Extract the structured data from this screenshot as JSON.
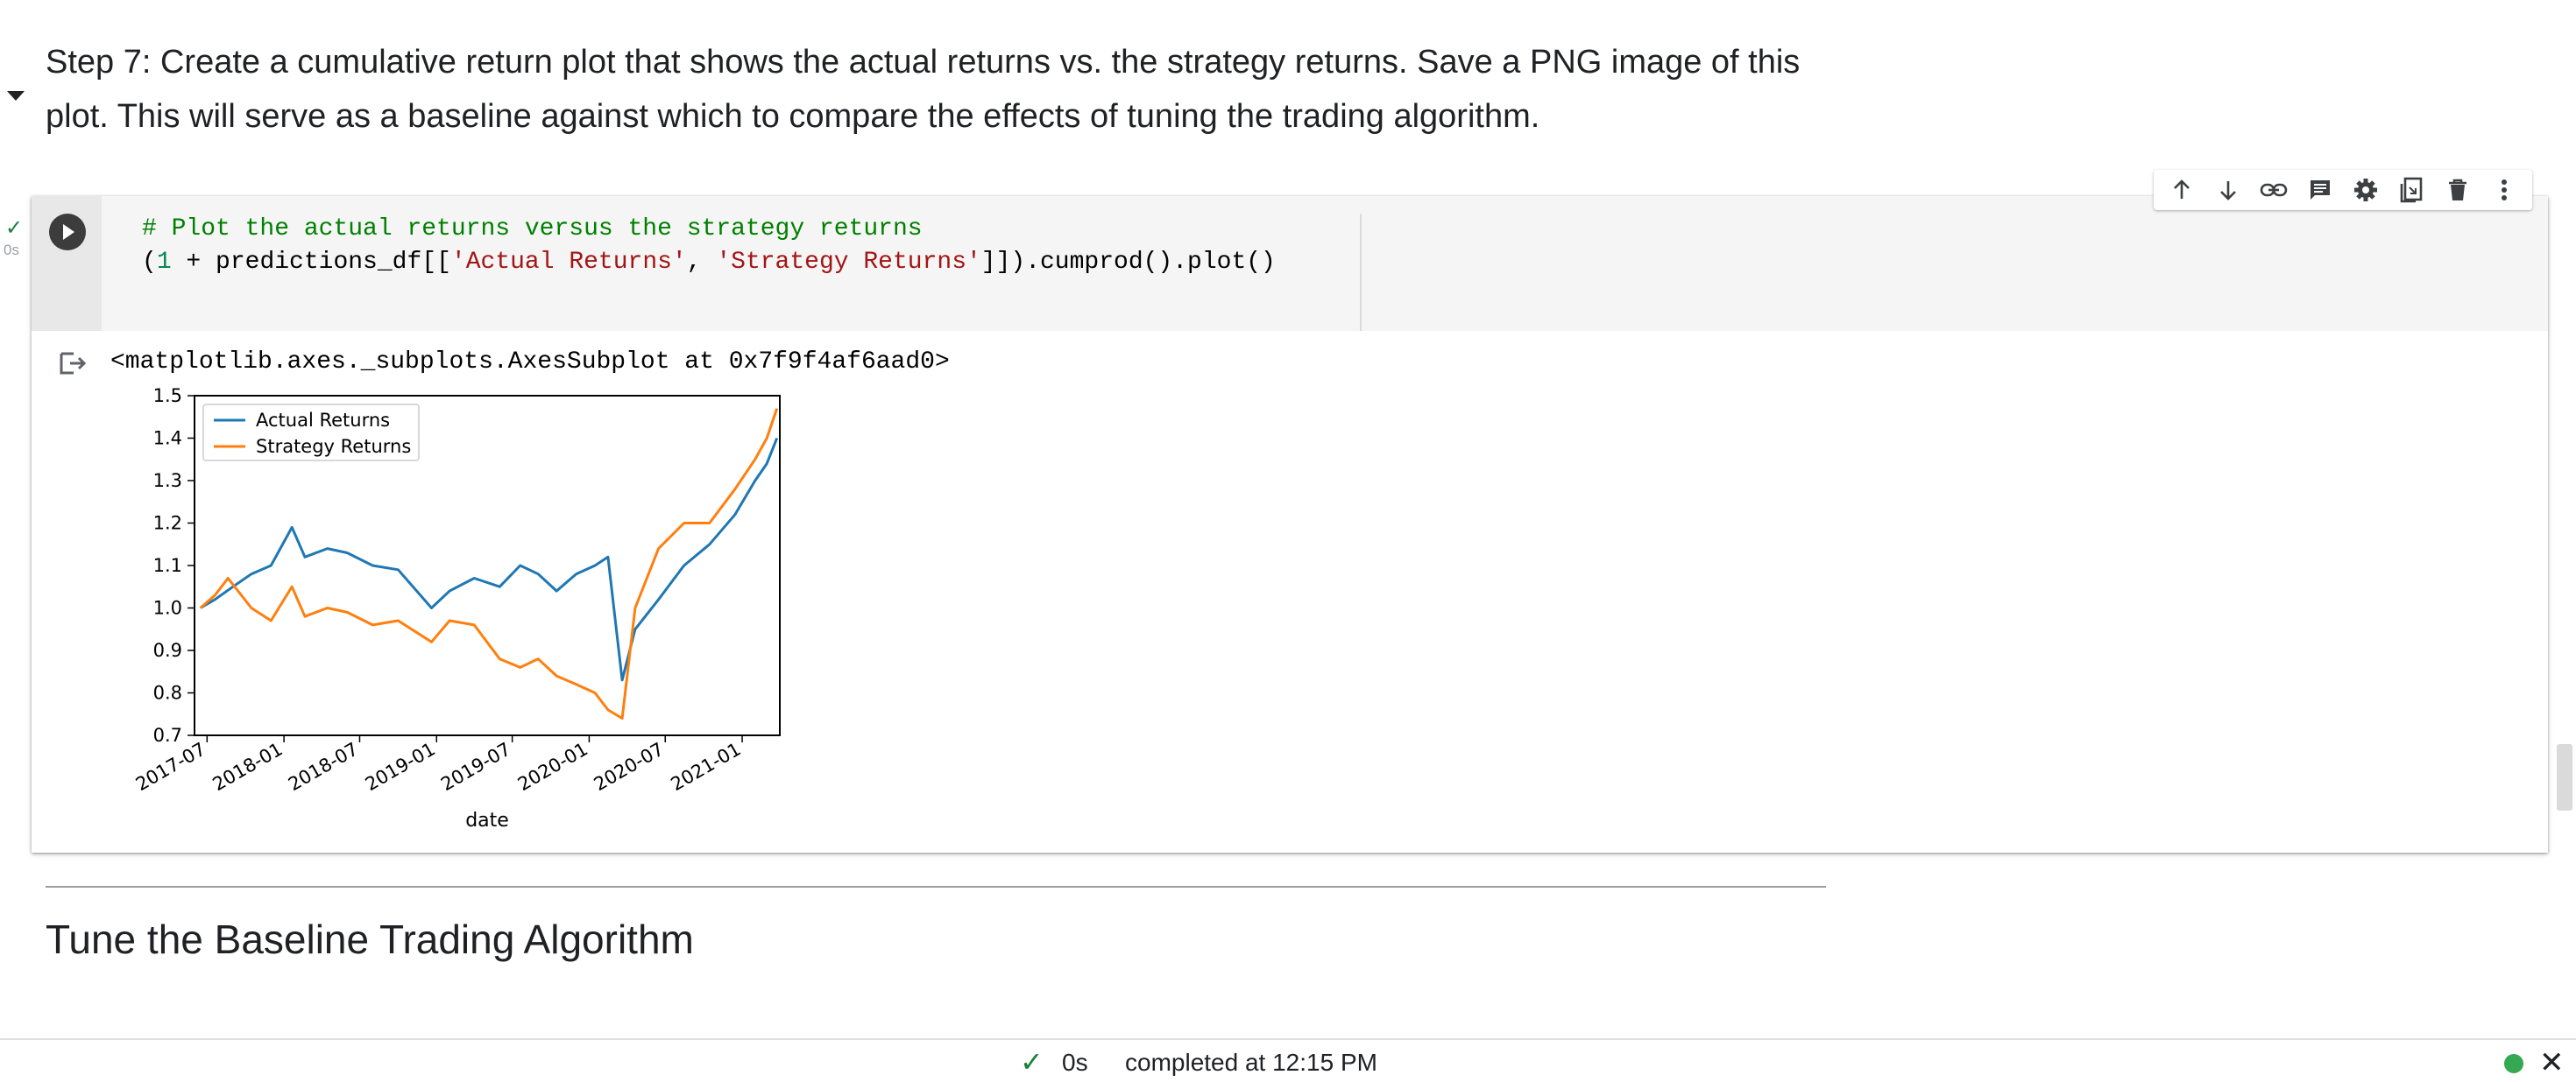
{
  "markdown": {
    "step_text": "Step 7: Create a cumulative return plot that shows the actual returns vs. the strategy returns. Save a PNG image of this plot. This will serve as a baseline against which to compare the effects of tuning the trading algorithm."
  },
  "cell": {
    "exec_time": "0s",
    "code_comment": "# Plot the actual returns versus the strategy returns",
    "code_open": "(",
    "code_num": "1",
    "code_mid": " + predictions_df[[",
    "code_str1": "'Actual Returns'",
    "code_comma": ", ",
    "code_str2": "'Strategy Returns'",
    "code_end": "]]).cumprod().plot()",
    "output_repr": "<matplotlib.axes._subplots.AxesSubplot at 0x7f9f4af6aad0>"
  },
  "toolbar": {
    "icons": [
      "arrow-up-icon",
      "arrow-down-icon",
      "link-icon",
      "comment-icon",
      "gear-icon",
      "mirror-cell-icon",
      "trash-icon",
      "more-vert-icon"
    ]
  },
  "chart_data": {
    "type": "line",
    "title": "",
    "xlabel": "date",
    "ylabel": "",
    "x_ticks": [
      "2017-07",
      "2018-01",
      "2018-07",
      "2019-01",
      "2019-07",
      "2020-01",
      "2020-07",
      "2021-01"
    ],
    "y_ticks": [
      "0.7",
      "0.8",
      "0.9",
      "1.0",
      "1.1",
      "1.2",
      "1.3",
      "1.4",
      "1.5"
    ],
    "ylim": [
      0.7,
      1.5
    ],
    "xlim": [
      "2017-06",
      "2021-04"
    ],
    "legend_position": "top-left",
    "grid": false,
    "series": [
      {
        "name": "Actual Returns",
        "color": "#1f77b4",
        "points": [
          [
            "2017-06-15",
            1.0
          ],
          [
            "2017-07-20",
            1.02
          ],
          [
            "2017-09-01",
            1.05
          ],
          [
            "2017-10-15",
            1.08
          ],
          [
            "2017-12-01",
            1.1
          ],
          [
            "2018-01-20",
            1.19
          ],
          [
            "2018-02-20",
            1.12
          ],
          [
            "2018-04-15",
            1.14
          ],
          [
            "2018-06-01",
            1.13
          ],
          [
            "2018-08-01",
            1.1
          ],
          [
            "2018-10-01",
            1.09
          ],
          [
            "2018-12-20",
            1.0
          ],
          [
            "2019-02-01",
            1.04
          ],
          [
            "2019-04-01",
            1.07
          ],
          [
            "2019-06-01",
            1.05
          ],
          [
            "2019-07-20",
            1.1
          ],
          [
            "2019-09-01",
            1.08
          ],
          [
            "2019-10-15",
            1.04
          ],
          [
            "2019-12-01",
            1.08
          ],
          [
            "2020-01-15",
            1.1
          ],
          [
            "2020-02-15",
            1.12
          ],
          [
            "2020-03-20",
            0.83
          ],
          [
            "2020-04-20",
            0.95
          ],
          [
            "2020-06-15",
            1.02
          ],
          [
            "2020-08-15",
            1.1
          ],
          [
            "2020-10-15",
            1.15
          ],
          [
            "2020-12-15",
            1.22
          ],
          [
            "2021-02-01",
            1.3
          ],
          [
            "2021-03-01",
            1.34
          ],
          [
            "2021-03-25",
            1.4
          ]
        ]
      },
      {
        "name": "Strategy Returns",
        "color": "#ff7f0e",
        "points": [
          [
            "2017-06-15",
            1.0
          ],
          [
            "2017-07-20",
            1.03
          ],
          [
            "2017-08-20",
            1.07
          ],
          [
            "2017-10-15",
            1.0
          ],
          [
            "2017-12-01",
            0.97
          ],
          [
            "2018-01-20",
            1.05
          ],
          [
            "2018-02-20",
            0.98
          ],
          [
            "2018-04-15",
            1.0
          ],
          [
            "2018-06-01",
            0.99
          ],
          [
            "2018-08-01",
            0.96
          ],
          [
            "2018-10-01",
            0.97
          ],
          [
            "2018-12-20",
            0.92
          ],
          [
            "2019-02-01",
            0.97
          ],
          [
            "2019-04-01",
            0.96
          ],
          [
            "2019-06-01",
            0.88
          ],
          [
            "2019-07-20",
            0.86
          ],
          [
            "2019-09-01",
            0.88
          ],
          [
            "2019-10-15",
            0.84
          ],
          [
            "2019-12-01",
            0.82
          ],
          [
            "2020-01-15",
            0.8
          ],
          [
            "2020-02-15",
            0.76
          ],
          [
            "2020-03-20",
            0.74
          ],
          [
            "2020-04-20",
            1.0
          ],
          [
            "2020-06-15",
            1.14
          ],
          [
            "2020-08-15",
            1.2
          ],
          [
            "2020-10-15",
            1.2
          ],
          [
            "2020-12-15",
            1.28
          ],
          [
            "2021-02-01",
            1.35
          ],
          [
            "2021-03-01",
            1.4
          ],
          [
            "2021-03-25",
            1.47
          ]
        ]
      }
    ]
  },
  "section": {
    "title": "Tune the Baseline Trading Algorithm"
  },
  "status_bar": {
    "time": "0s",
    "text": "completed at 12:15 PM",
    "close": "✕",
    "check": "✓"
  }
}
